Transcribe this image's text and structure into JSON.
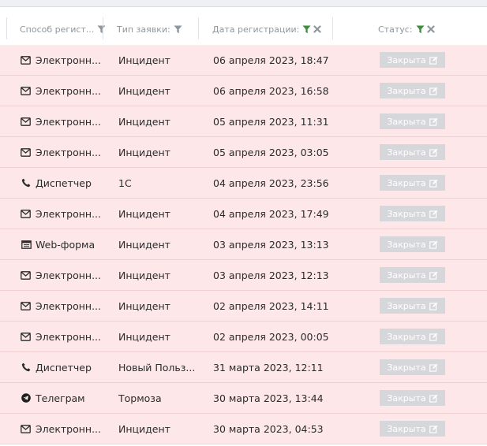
{
  "columns": [
    {
      "label": "Способ регист...",
      "filter_active": false,
      "clearable": false
    },
    {
      "label": "Тип заявки:",
      "filter_active": false,
      "clearable": false
    },
    {
      "label": "Дата регистрации:",
      "filter_active": true,
      "clearable": true
    },
    {
      "label": "Статус:",
      "filter_active": true,
      "clearable": true
    }
  ],
  "colors": {
    "row_bg": "#fde7e8",
    "row_border": "#f2cfd1",
    "filter_active": "#3a8f3a",
    "filter_inactive": "#8e969e",
    "badge_bg": "#d5d7da"
  },
  "rows": [
    {
      "icon": "envelope-icon",
      "method": "Электронн...",
      "type": "Инцидент",
      "date": "06 апреля 2023, 18:47",
      "status": "Закрыта"
    },
    {
      "icon": "envelope-icon",
      "method": "Электронн...",
      "type": "Инцидент",
      "date": "06 апреля 2023, 16:58",
      "status": "Закрыта"
    },
    {
      "icon": "envelope-icon",
      "method": "Электронн...",
      "type": "Инцидент",
      "date": "05 апреля 2023, 11:31",
      "status": "Закрыта"
    },
    {
      "icon": "envelope-icon",
      "method": "Электронн...",
      "type": "Инцидент",
      "date": "05 апреля 2023, 03:05",
      "status": "Закрыта"
    },
    {
      "icon": "phone-icon",
      "method": "Диспетчер",
      "type": "1С",
      "date": "04 апреля 2023, 23:56",
      "status": "Закрыта"
    },
    {
      "icon": "envelope-icon",
      "method": "Электронн...",
      "type": "Инцидент",
      "date": "04 апреля 2023, 17:49",
      "status": "Закрыта"
    },
    {
      "icon": "webform-icon",
      "method": "Web-форма",
      "type": "Инцидент",
      "date": "03 апреля 2023, 13:13",
      "status": "Закрыта"
    },
    {
      "icon": "envelope-icon",
      "method": "Электронн...",
      "type": "Инцидент",
      "date": "03 апреля 2023, 12:13",
      "status": "Закрыта"
    },
    {
      "icon": "envelope-icon",
      "method": "Электронн...",
      "type": "Инцидент",
      "date": "02 апреля 2023, 14:11",
      "status": "Закрыта"
    },
    {
      "icon": "envelope-icon",
      "method": "Электронн...",
      "type": "Инцидент",
      "date": "02 апреля 2023, 00:05",
      "status": "Закрыта"
    },
    {
      "icon": "phone-icon",
      "method": "Диспетчер",
      "type": "Новый Польз...",
      "date": "31 марта 2023, 12:11",
      "status": "Закрыта"
    },
    {
      "icon": "telegram-icon",
      "method": "Телеграм",
      "type": "Тормоза",
      "date": "30 марта 2023, 13:44",
      "status": "Закрыта"
    },
    {
      "icon": "envelope-icon",
      "method": "Электронн...",
      "type": "Инцидент",
      "date": "30 марта 2023, 04:53",
      "status": "Закрыта"
    }
  ]
}
